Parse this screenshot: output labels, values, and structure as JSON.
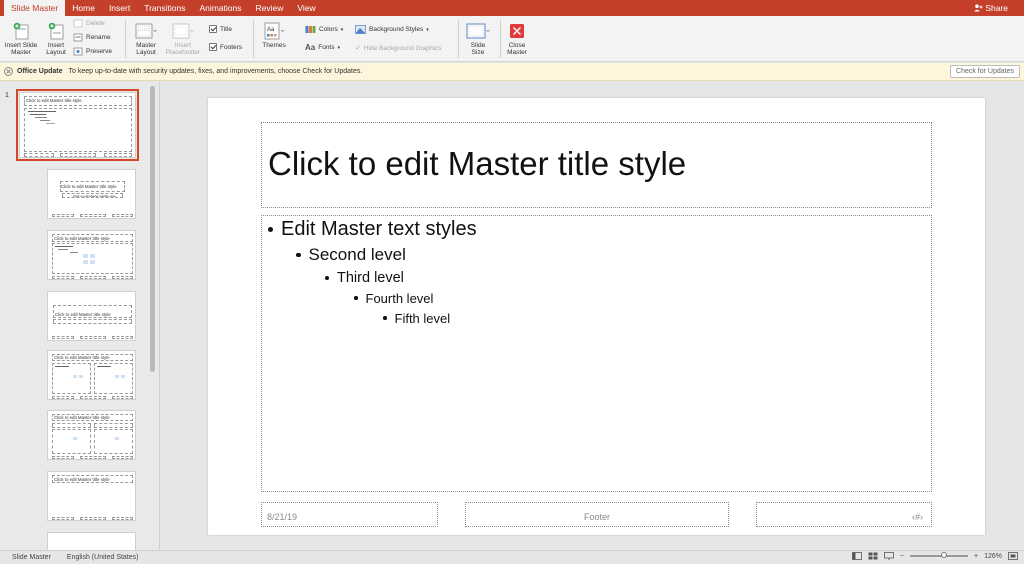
{
  "tabs": [
    "Slide Master",
    "Home",
    "Insert",
    "Transitions",
    "Animations",
    "Review",
    "View"
  ],
  "share_label": "Share",
  "ribbon": {
    "insert_slide_master": [
      "Insert Slide",
      "Master"
    ],
    "insert_layout": [
      "Insert",
      "Layout"
    ],
    "delete": "Delete",
    "rename": "Rename",
    "preserve": "Preserve",
    "master_layout": [
      "Master",
      "Layout"
    ],
    "insert_placeholder": [
      "Insert",
      "Placeholder"
    ],
    "title_check": "Title",
    "footers_check": "Footers",
    "themes": "Themes",
    "colors": "Colors",
    "fonts": "Fonts",
    "background_styles": "Background Styles",
    "hide_bg_graphics": "Hide Background Graphics",
    "slide_size": [
      "Slide",
      "Size"
    ],
    "close_master": [
      "Close",
      "Master"
    ]
  },
  "update_bar": {
    "title": "Office Update",
    "message": "To keep up-to-date with security updates, fixes, and improvements, choose Check for Updates.",
    "button": "Check for Updates"
  },
  "thumbnails": {
    "first_number": "1",
    "master_title": "Click to edit Master title style",
    "title_style": "Click to edit Master title style",
    "subtitle_style": "Click to edit Master subtitle style"
  },
  "slide": {
    "title": "Click to edit Master title style",
    "levels": [
      "Edit Master text styles",
      "Second level",
      "Third level",
      "Fourth level",
      "Fifth level"
    ],
    "date": "8/21/19",
    "footer": "Footer",
    "page_number": "‹#›"
  },
  "status": {
    "view": "Slide Master",
    "language": "English (United States)",
    "zoom_level": "126%",
    "zoom_fraction": 0.58
  },
  "colors": {
    "accent": "#c4402b",
    "selection": "#d24726",
    "close_red": "#e03b3b"
  }
}
